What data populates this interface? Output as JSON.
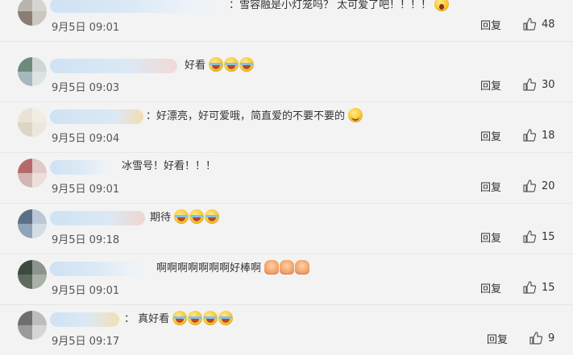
{
  "comments": [
    {
      "text": "：雪容融是小灯笼吗？ 太可爱了吧！！！！",
      "emojis": [
        "shock"
      ],
      "date": "9月5日 09:01",
      "reply": "回复",
      "likes": "48"
    },
    {
      "text": "好看",
      "emojis": [
        "cry",
        "cry",
        "cry"
      ],
      "date": "9月5日 09:03",
      "reply": "回复",
      "likes": "30"
    },
    {
      "text": "：好漂亮，好可爱哦，简直爱的不要不要的",
      "emojis": [
        "smile"
      ],
      "date": "9月5日 09:04",
      "reply": "回复",
      "likes": "18"
    },
    {
      "text": "冰雪号！好看！！！",
      "emojis": [],
      "date": "9月5日 09:01",
      "reply": "回复",
      "likes": "20"
    },
    {
      "text": "期待",
      "emojis": [
        "cry",
        "cry",
        "cry"
      ],
      "date": "9月5日 09:18",
      "reply": "回复",
      "likes": "15"
    },
    {
      "text": "啊啊啊啊啊啊啊好棒啊",
      "emojis": [
        "clap",
        "clap",
        "clap"
      ],
      "date": "9月5日 09:01",
      "reply": "回复",
      "likes": "15"
    },
    {
      "text": "： 真好看",
      "emojis": [
        "cry",
        "cry",
        "cry",
        "cry"
      ],
      "date": "9月5日 09:17",
      "reply": "回复",
      "likes": "9"
    }
  ],
  "colors": {
    "background": "#f3f3f3",
    "username_blur": "#cfe2f3",
    "emoji_yellow": "#f9c733",
    "text": "#333333"
  },
  "icons": {
    "like": "thumbs-up-icon",
    "emoji_shock": "shocked-face-icon",
    "emoji_cry": "crying-face-icon",
    "emoji_smile": "smile-face-icon",
    "emoji_clap": "clapping-hands-icon"
  }
}
